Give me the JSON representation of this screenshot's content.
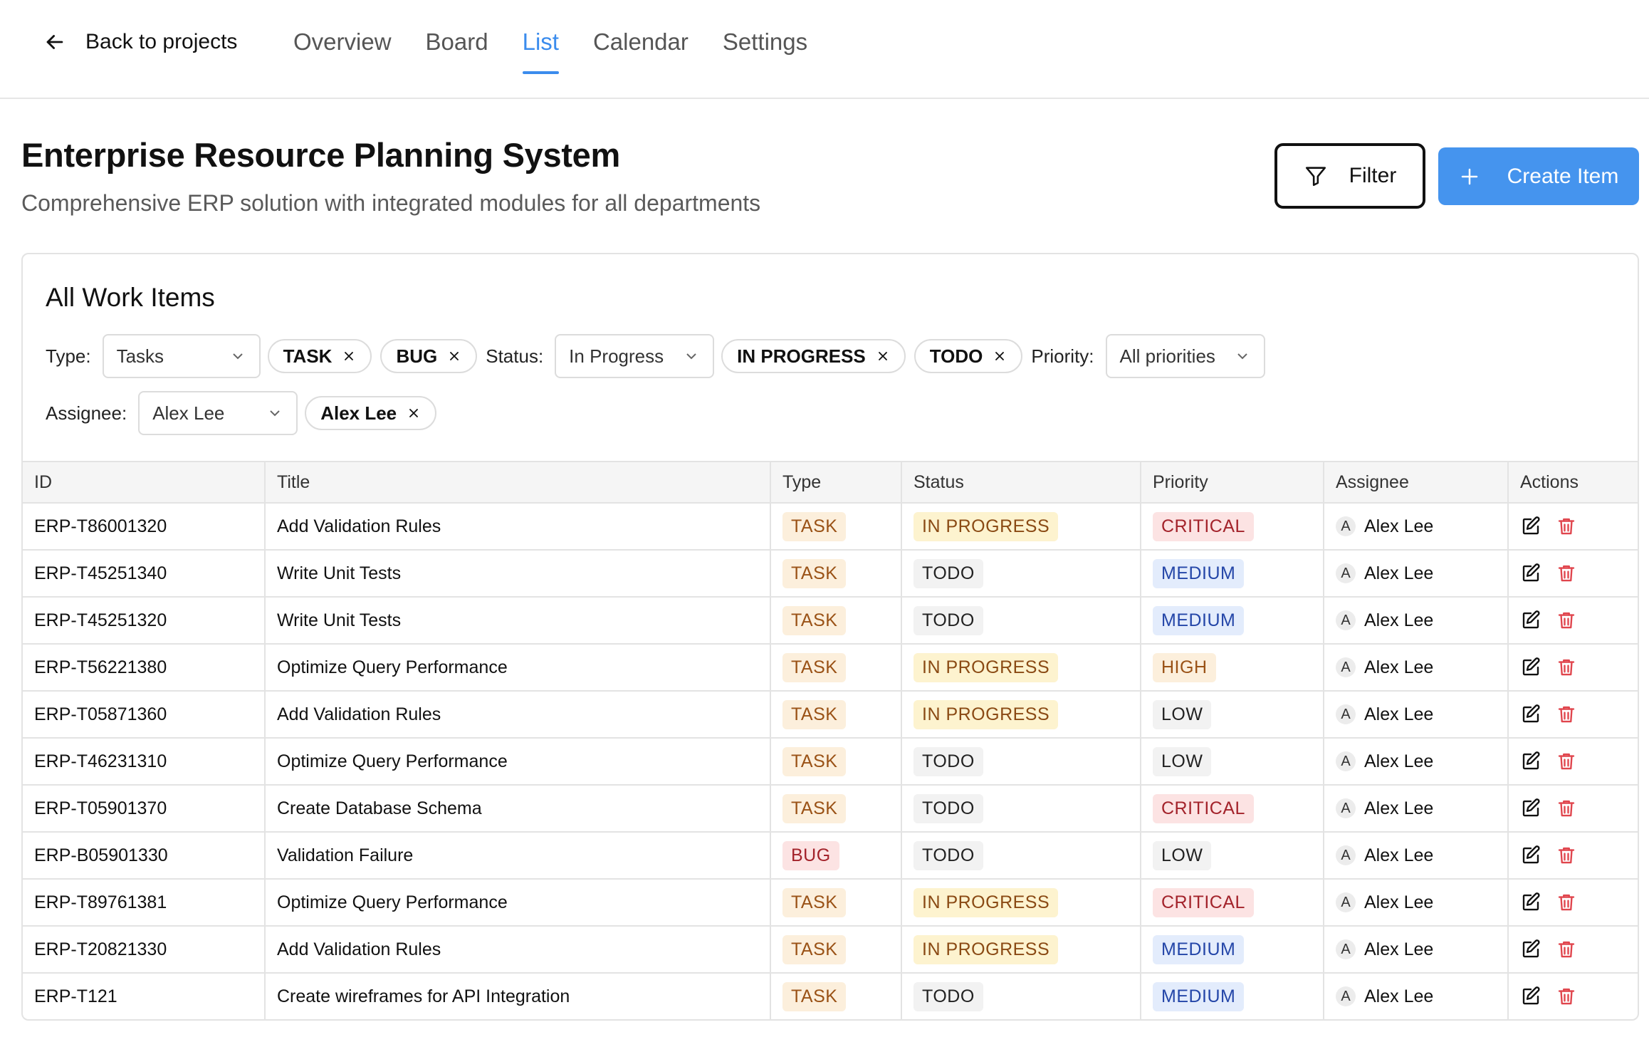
{
  "nav": {
    "back_label": "Back to projects",
    "tabs": [
      "Overview",
      "Board",
      "List",
      "Calendar",
      "Settings"
    ],
    "active_tab": "List"
  },
  "header": {
    "title": "Enterprise Resource Planning System",
    "subtitle": "Comprehensive ERP solution with integrated modules for all departments",
    "filter_label": "Filter",
    "create_label": "Create Item"
  },
  "card": {
    "title": "All Work Items"
  },
  "filters": {
    "type_label": "Type:",
    "type_value": "Tasks",
    "type_chips": [
      "TASK",
      "BUG"
    ],
    "status_label": "Status:",
    "status_value": "In Progress",
    "status_chips": [
      "IN PROGRESS",
      "TODO"
    ],
    "priority_label": "Priority:",
    "priority_value": "All priorities",
    "assignee_label": "Assignee:",
    "assignee_value": "Alex Lee",
    "assignee_chips": [
      "Alex Lee"
    ]
  },
  "table": {
    "columns": [
      "ID",
      "Title",
      "Type",
      "Status",
      "Priority",
      "Assignee",
      "Actions"
    ],
    "rows": [
      {
        "id": "ERP-T86001320",
        "title": "Add Validation Rules",
        "type": "TASK",
        "status": "IN PROGRESS",
        "priority": "CRITICAL",
        "assignee": "Alex Lee",
        "avatar": "A"
      },
      {
        "id": "ERP-T45251340",
        "title": "Write Unit Tests",
        "type": "TASK",
        "status": "TODO",
        "priority": "MEDIUM",
        "assignee": "Alex Lee",
        "avatar": "A"
      },
      {
        "id": "ERP-T45251320",
        "title": "Write Unit Tests",
        "type": "TASK",
        "status": "TODO",
        "priority": "MEDIUM",
        "assignee": "Alex Lee",
        "avatar": "A"
      },
      {
        "id": "ERP-T56221380",
        "title": "Optimize Query Performance",
        "type": "TASK",
        "status": "IN PROGRESS",
        "priority": "HIGH",
        "assignee": "Alex Lee",
        "avatar": "A"
      },
      {
        "id": "ERP-T05871360",
        "title": "Add Validation Rules",
        "type": "TASK",
        "status": "IN PROGRESS",
        "priority": "LOW",
        "assignee": "Alex Lee",
        "avatar": "A"
      },
      {
        "id": "ERP-T46231310",
        "title": "Optimize Query Performance",
        "type": "TASK",
        "status": "TODO",
        "priority": "LOW",
        "assignee": "Alex Lee",
        "avatar": "A"
      },
      {
        "id": "ERP-T05901370",
        "title": "Create Database Schema",
        "type": "TASK",
        "status": "TODO",
        "priority": "CRITICAL",
        "assignee": "Alex Lee",
        "avatar": "A"
      },
      {
        "id": "ERP-B05901330",
        "title": "Validation Failure",
        "type": "BUG",
        "status": "TODO",
        "priority": "LOW",
        "assignee": "Alex Lee",
        "avatar": "A"
      },
      {
        "id": "ERP-T89761381",
        "title": "Optimize Query Performance",
        "type": "TASK",
        "status": "IN PROGRESS",
        "priority": "CRITICAL",
        "assignee": "Alex Lee",
        "avatar": "A"
      },
      {
        "id": "ERP-T20821330",
        "title": "Add Validation Rules",
        "type": "TASK",
        "status": "IN PROGRESS",
        "priority": "MEDIUM",
        "assignee": "Alex Lee",
        "avatar": "A"
      },
      {
        "id": "ERP-T121",
        "title": "Create wireframes for API Integration",
        "type": "TASK",
        "status": "TODO",
        "priority": "MEDIUM",
        "assignee": "Alex Lee",
        "avatar": "A"
      }
    ]
  },
  "icons": {
    "back": "arrow-left-icon",
    "filter": "funnel-icon",
    "create": "plus-icon",
    "chip_remove": "close-icon",
    "select": "chevron-down-icon",
    "edit": "edit-icon",
    "delete": "trash-icon"
  },
  "colors": {
    "accent": "#3b8ced",
    "create_button": "#4594ee",
    "delete_icon": "#e0454d"
  }
}
